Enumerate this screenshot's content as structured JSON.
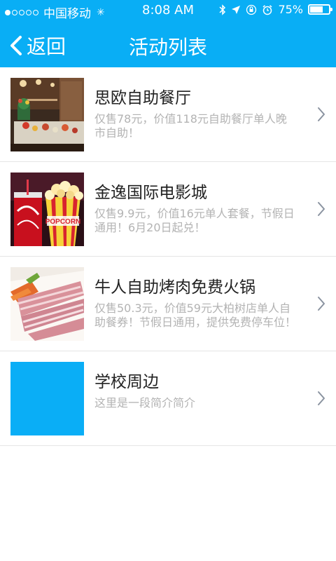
{
  "status_bar": {
    "carrier": "中国移动",
    "time": "8:08 AM",
    "battery": "75%",
    "battery_level": 0.75,
    "signal_icon": "signal-dots-icon",
    "loading_icon": "loading-spinner-icon"
  },
  "navbar": {
    "back_label": "返回",
    "title": "活动列表"
  },
  "items": [
    {
      "title": "思欧自助餐厅",
      "desc": "仅售78元，价值118元自助餐厅单人晚市自助！",
      "image": "restaurant-photo"
    },
    {
      "title": "金逸国际电影城",
      "desc": "仅售9.9元，价值16元单人套餐，节假日通用！6月20日起兑！",
      "image": "popcorn-cola-photo",
      "image_text": "POPCORN"
    },
    {
      "title": "牛人自助烤肉免费火锅",
      "desc": "仅售50.3元，价值59元大柏树店单人自助餐券！节假日通用，提供免费停车位！",
      "image": "bacon-plate-photo"
    },
    {
      "title": "学校周边",
      "desc": "这里是一段简介简介",
      "image": "blue-placeholder",
      "image_color": "#0aaef6"
    }
  ],
  "colors": {
    "header_bg": "#09aef5",
    "desc_text": "#b3b3b3",
    "title_text": "#222222"
  }
}
